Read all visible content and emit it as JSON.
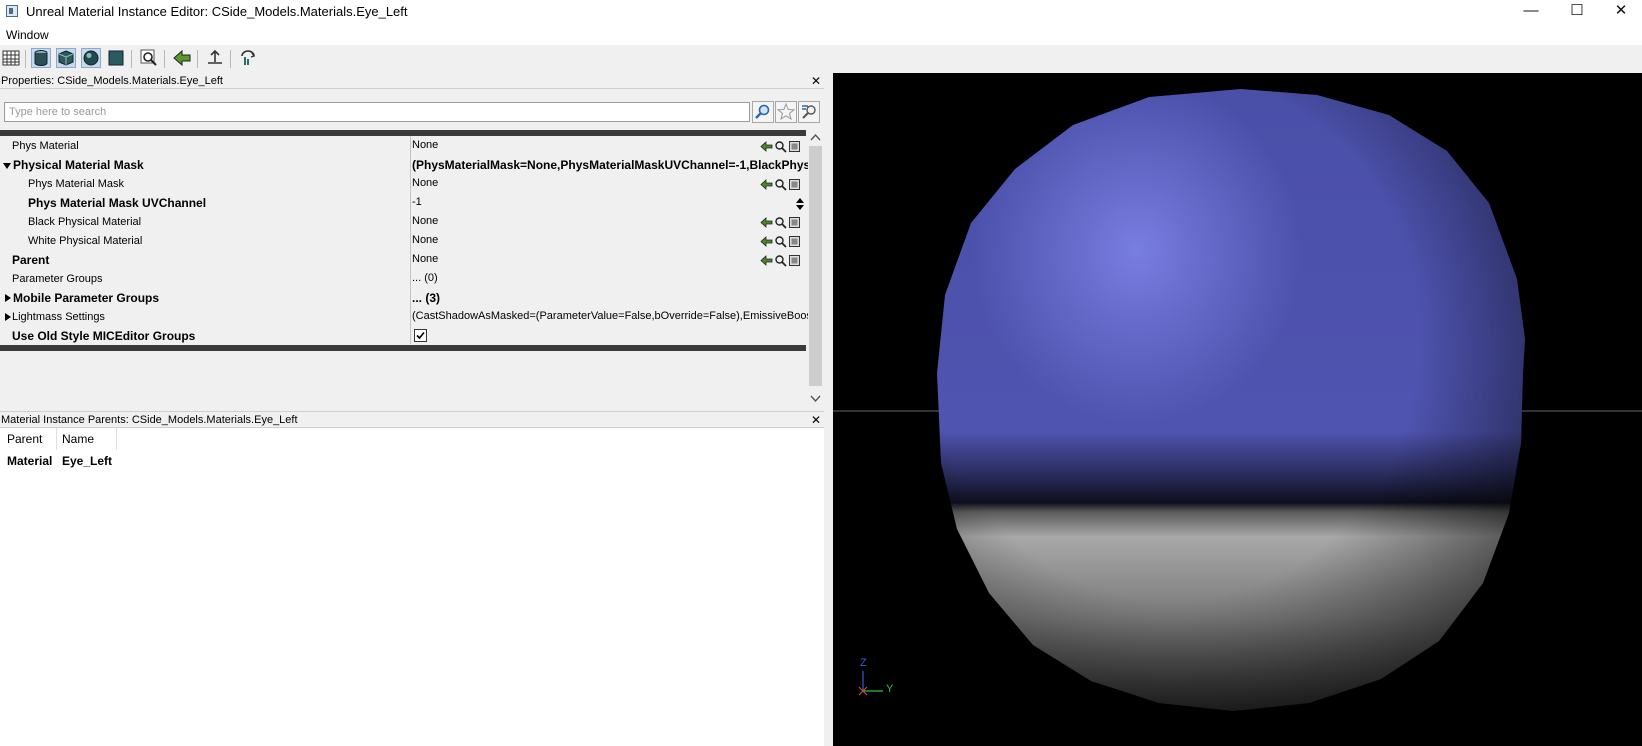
{
  "window": {
    "title": "Unreal Material Instance Editor: CSide_Models.Materials.Eye_Left",
    "minimize": "—",
    "maximize": "☐",
    "close": "✕"
  },
  "menu": {
    "items": [
      "Window"
    ]
  },
  "toolbar": {
    "buttons": [
      "grid-icon",
      "cylinder-icon",
      "cube-icon",
      "sphere-icon",
      "plane-icon",
      "find-icon",
      "back-arrow-icon",
      "pivot-icon",
      "reset-icon"
    ]
  },
  "properties_panel": {
    "title": "Properties: CSide_Models.Materials.Eye_Left",
    "close": "✕",
    "search_placeholder": "Type here to search",
    "rows": [
      {
        "label": "Phys Material",
        "value": "None"
      },
      {
        "label": "Physical Material Mask",
        "value": "(PhysMaterialMask=None,PhysMaterialMaskUVChannel=-1,BlackPhys"
      },
      {
        "label": "Phys Material Mask",
        "value": "None"
      },
      {
        "label": "Phys Material Mask UVChannel",
        "value": "-1"
      },
      {
        "label": "Black Physical Material",
        "value": "None"
      },
      {
        "label": "White Physical Material",
        "value": "None"
      },
      {
        "label": "Parent",
        "value": "None"
      },
      {
        "label": "Parameter Groups",
        "value": "... (0)"
      },
      {
        "label": "Mobile Parameter Groups",
        "value": "... (3)"
      },
      {
        "label": "Lightmass Settings",
        "value": "(CastShadowAsMasked=(ParameterValue=False,bOverride=False),EmissiveBoost"
      },
      {
        "label": "Use Old Style MICEditor Groups",
        "value": "checked"
      }
    ]
  },
  "parents_panel": {
    "title": "Material Instance Parents: CSide_Models.Materials.Eye_Left",
    "close": "✕",
    "columns": [
      "Parent",
      "Name"
    ],
    "rows": [
      {
        "parent": "Material",
        "name": "Eye_Left"
      }
    ]
  },
  "viewport": {
    "axis_z": "Z",
    "axis_y": "Y",
    "axis_x": "X",
    "sphere_top_color": "#5a5fc0",
    "sphere_bottom_color": "#8a8a8a"
  }
}
